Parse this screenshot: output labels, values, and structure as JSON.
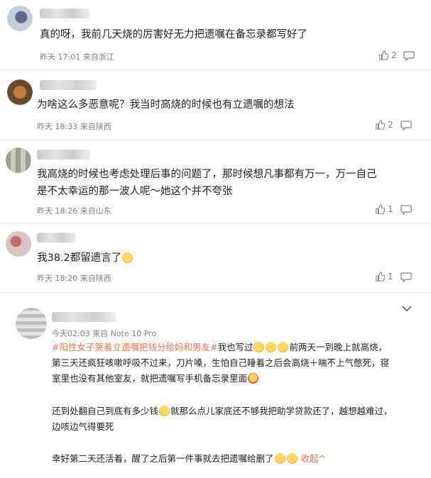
{
  "comments": [
    {
      "text": "真的呀，我前几天烧的厉害好无力把遗嘱在备忘录都写好了",
      "time": "昨天 17:01",
      "source": "来自浙江",
      "likes": "2"
    },
    {
      "text": "为啥这么多恶意呢？我当时高烧的时候也有立遗嘱的想法",
      "time": "昨天 18:33",
      "source": "来自陕西",
      "likes": "2"
    },
    {
      "text_line1": "我高烧的时候也考虑处理后事的问题了，那时候想凡事都有万一，万一自己",
      "text_line2": "是不太幸运的那一波人呢～她这个并不夸张",
      "time": "昨天 18:26",
      "source": "来自山东",
      "likes": "1"
    },
    {
      "text": "我38.2都留遗言了",
      "time": "昨天 18:20",
      "source": "来自陕西",
      "likes": "1"
    }
  ],
  "post": {
    "time": "今天02:03",
    "source": "来自 Note 10 Pro",
    "hashtag": "#阳性女子哭着立遗嘱把钱分给妈和男友#",
    "line1_rest": "我也写过",
    "line1_end": "前两天一到晚上就高烧，",
    "line2": "第三天还疯狂咳嗽呼吸不过来，刀片嗓，生怕自己睡着之后会高烧＋喘不上气憋死，寝",
    "line3": "室里也没有其他室友，就把遗嘱写手机备忘录里面",
    "para2_line1": "还到处翻自己到底有多少钱",
    "para2_line1_rest": "就那么点儿家底还不够我把助学贷款还了，越想越难过，",
    "para2_line2": "边咳边气得要死",
    "para3": "幸好第二天还活着，醒了之后第一件事就去把遗嘱给删了",
    "collapse_label": "收起"
  },
  "icons": {
    "like": "thumbs-up-icon",
    "reply": "comment-icon",
    "expand": "chevron-down-icon",
    "collapse": "chevron-up-icon"
  },
  "colors": {
    "accent": "#eb7350",
    "meta": "#808080"
  }
}
